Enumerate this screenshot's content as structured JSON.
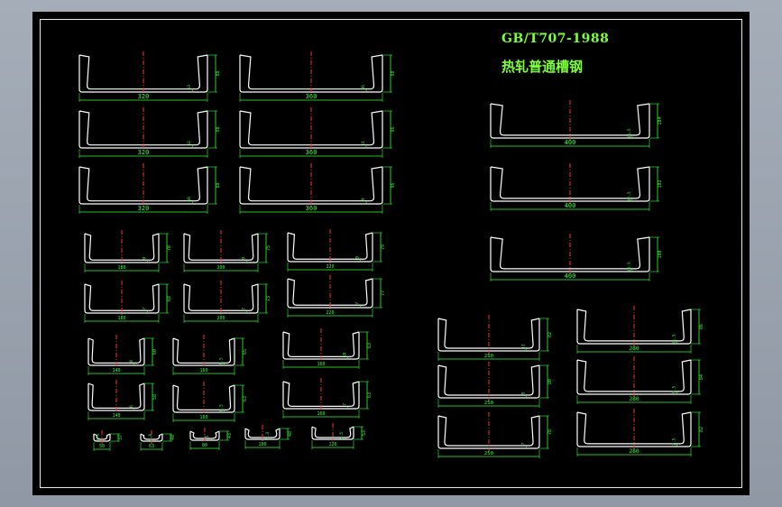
{
  "drawing": {
    "standard": "GB/T707-1988",
    "name": "热轧普通槽钢"
  },
  "colors": {
    "background": "#000000",
    "profile": "#ffffff",
    "dimension": "#33ff33",
    "centerline": "#ff3030",
    "title": "#7cff3a",
    "frame": "#e8e8e8"
  },
  "channel_profiles": [
    {
      "size": "320",
      "thickness": "13",
      "flange": "88"
    },
    {
      "size": "360",
      "thickness": "96",
      "flange": "98"
    },
    {
      "size": "320",
      "thickness": "12",
      "flange": "90"
    },
    {
      "size": "360",
      "thickness": "11",
      "flange": "96"
    },
    {
      "size": "320",
      "thickness": "10",
      "flange": "88"
    },
    {
      "size": "360",
      "thickness": "9",
      "flange": "96"
    },
    {
      "size": "400",
      "thickness": "14.5",
      "flange": "104"
    },
    {
      "size": "400",
      "thickness": "12.5",
      "flange": "102"
    },
    {
      "size": "400",
      "thickness": "10.5",
      "flange": "100"
    },
    {
      "size": "180",
      "thickness": "9",
      "flange": "70"
    },
    {
      "size": "200",
      "thickness": "9",
      "flange": "75"
    },
    {
      "size": "220",
      "thickness": "9",
      "flange": "79"
    },
    {
      "size": "180",
      "thickness": "7",
      "flange": "68"
    },
    {
      "size": "200",
      "thickness": "7",
      "flange": "73"
    },
    {
      "size": "220",
      "thickness": "7",
      "flange": "77"
    },
    {
      "size": "140",
      "thickness": "8",
      "flange": "60"
    },
    {
      "size": "160",
      "thickness": "8.5",
      "flange": "65"
    },
    {
      "size": "160",
      "thickness": "10",
      "flange": "63"
    },
    {
      "size": "140",
      "thickness": "6",
      "flange": "58"
    },
    {
      "size": "160",
      "thickness": "6.5",
      "flange": "63"
    },
    {
      "size": "160",
      "thickness": "7",
      "flange": "63"
    },
    {
      "size": "50",
      "thickness": "4.5",
      "flange": "37"
    },
    {
      "size": "63",
      "thickness": "4.8",
      "flange": "40"
    },
    {
      "size": "80",
      "thickness": "5",
      "flange": "43"
    },
    {
      "size": "100",
      "thickness": "5.3",
      "flange": "48"
    },
    {
      "size": "126",
      "thickness": "5.5",
      "flange": "53"
    },
    {
      "size": "250",
      "thickness": "11",
      "flange": "82"
    },
    {
      "size": "250",
      "thickness": "9",
      "flange": "80"
    },
    {
      "size": "250",
      "thickness": "7",
      "flange": "78"
    },
    {
      "size": "280",
      "thickness": "11.5",
      "flange": "86"
    },
    {
      "size": "280",
      "thickness": "9.5",
      "flange": "84"
    },
    {
      "size": "280",
      "thickness": "7.5",
      "flange": "82"
    }
  ]
}
